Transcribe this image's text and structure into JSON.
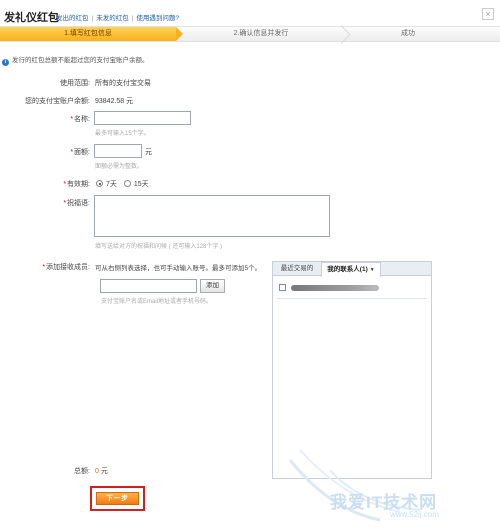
{
  "header": {
    "title": "发礼仪红包",
    "links": [
      "发出的红包",
      "未发的红包",
      "使用遇到问题?"
    ],
    "close_glyph": "×"
  },
  "steps": [
    "1.填写红包信息",
    "2.确认信息并发行",
    "成功"
  ],
  "notice": "发行的红包总额不能超过您的支付宝账户余额。",
  "form": {
    "scope_label": "使用范围:",
    "scope_value": "所有的支付宝交易",
    "balance_label": "您的支付宝账户余额:",
    "balance_value": "93842.58 元",
    "name_label": "名称:",
    "name_hint": "最多可输入15个字。",
    "amount_label": "面额:",
    "amount_unit": "元",
    "amount_hint": "面额必需为整数。",
    "validity_label": "有效期:",
    "validity_options": [
      "7天",
      "15天"
    ],
    "validity_selected": "7天",
    "greeting_label": "祝福语:",
    "greeting_hint": "填写送给对方的祝福和问候 ( 还可输入128个字 )",
    "recipients_label": "添加接收成员:",
    "recipients_desc": "可从右侧列表选择，也可手动输入账号。最多可添加5个。",
    "add_button": "添加",
    "recipients_hint": "支付宝账户名或Email地址或者手机号码。",
    "total_label": "总额:",
    "total_value": "0",
    "total_unit": "元",
    "next_button": "下一步"
  },
  "contacts_panel": {
    "tabs": [
      "最近交易的",
      "我的联系人(1)"
    ],
    "active_tab": "我的联系人(1)"
  },
  "required_mark": "*",
  "watermark": {
    "text": "我爱IT技术网",
    "url": "www.52ij.com"
  },
  "colors": {
    "accent": "#f5b21b",
    "link": "#1a5fa8",
    "required": "#d40000",
    "button": "#f07b12",
    "highlight_border": "#d21f1f"
  }
}
